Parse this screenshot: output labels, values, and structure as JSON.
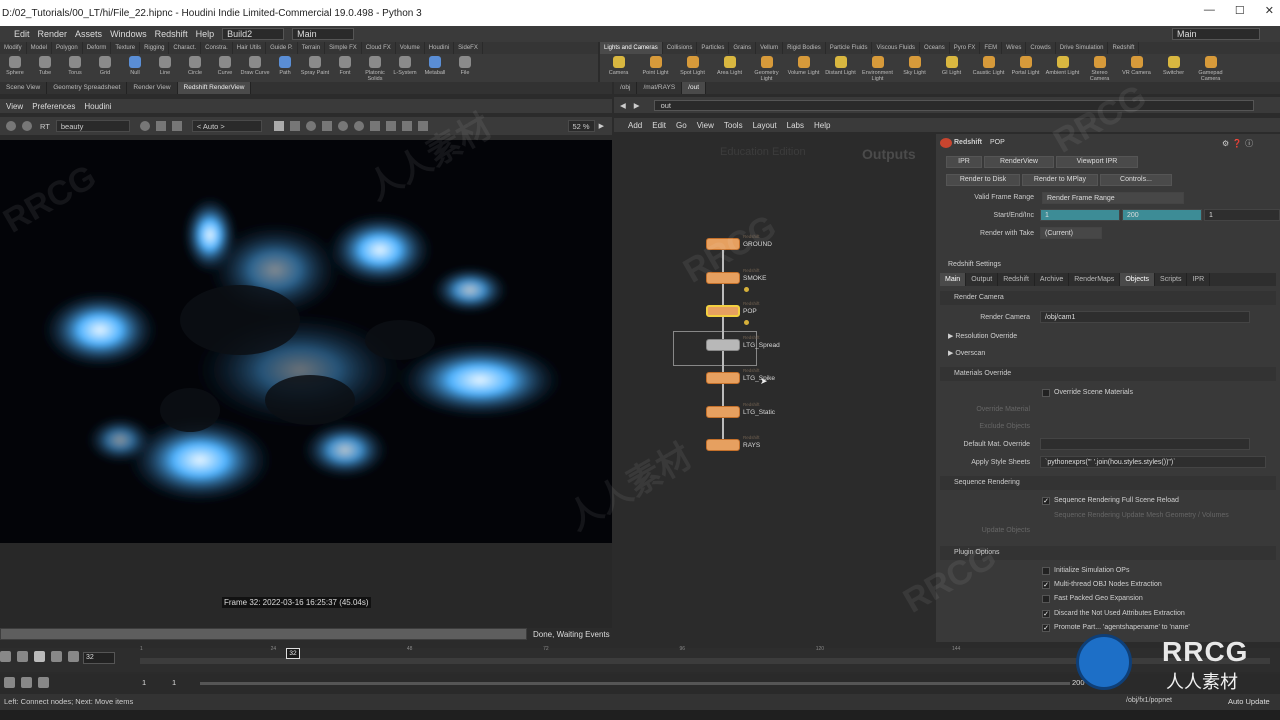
{
  "window": {
    "title": "D:/02_Tutorials/00_LT/hi/File_22.hipnc - Houdini Indie Limited-Commercial 19.0.498 - Python 3",
    "controls": [
      "—",
      "☐",
      "✕"
    ]
  },
  "menubar": {
    "items": [
      "Edit",
      "Render",
      "Assets",
      "Windows",
      "Redshift",
      "Help"
    ],
    "desktop": "Build2",
    "desktop_main": "Main",
    "right_main": "Main"
  },
  "shelf_tabs_left": [
    "Modify",
    "Model",
    "Polygon",
    "Deform",
    "Texture",
    "Rigging",
    "Charact.",
    "Constra.",
    "Hair Utils",
    "Guide P.",
    "Terrain",
    "Simple FX",
    "Cloud FX",
    "Volume",
    "Houdini",
    "SideFX"
  ],
  "shelf_tabs_right": [
    "Lights and Cameras",
    "Collisions",
    "Particles",
    "Grains",
    "Vellum",
    "Rigid Bodies",
    "Particle Fluids",
    "Viscous Fluids",
    "Oceans",
    "Pyro FX",
    "FEM",
    "Wires",
    "Crowds",
    "Drive Simulation",
    "Redshift"
  ],
  "shelf_tools_left": [
    {
      "label": "Sphere",
      "icon": "sphere-icon"
    },
    {
      "label": "Tube",
      "icon": "tube-icon"
    },
    {
      "label": "Torus",
      "icon": "torus-icon"
    },
    {
      "label": "Grid",
      "icon": "grid-icon"
    },
    {
      "label": "Null",
      "icon": "null-icon"
    },
    {
      "label": "Line",
      "icon": "line-icon"
    },
    {
      "label": "Circle",
      "icon": "circle-icon"
    },
    {
      "label": "Curve",
      "icon": "curve-icon"
    },
    {
      "label": "Draw Curve",
      "icon": "draw-curve-icon"
    },
    {
      "label": "Path",
      "icon": "path-icon"
    },
    {
      "label": "Spray Paint",
      "icon": "spray-paint-icon"
    },
    {
      "label": "Font",
      "icon": "font-icon"
    },
    {
      "label": "Platonic Solids",
      "icon": "platonic-icon"
    },
    {
      "label": "L-System",
      "icon": "lsystem-icon"
    },
    {
      "label": "Metaball",
      "icon": "metaball-icon"
    },
    {
      "label": "File",
      "icon": "file-icon"
    }
  ],
  "shelf_tools_right": [
    {
      "label": "Camera",
      "icon": "camera-icon"
    },
    {
      "label": "Point Light",
      "icon": "point-light-icon"
    },
    {
      "label": "Spot Light",
      "icon": "spot-light-icon"
    },
    {
      "label": "Area Light",
      "icon": "area-light-icon"
    },
    {
      "label": "Geometry Light",
      "icon": "geometry-light-icon"
    },
    {
      "label": "Volume Light",
      "icon": "volume-light-icon"
    },
    {
      "label": "Distant Light",
      "icon": "distant-light-icon"
    },
    {
      "label": "Environment Light",
      "icon": "environment-light-icon"
    },
    {
      "label": "Sky Light",
      "icon": "sky-light-icon"
    },
    {
      "label": "GI Light",
      "icon": "gi-light-icon"
    },
    {
      "label": "Caustic Light",
      "icon": "caustic-light-icon"
    },
    {
      "label": "Portal Light",
      "icon": "portal-light-icon"
    },
    {
      "label": "Ambient Light",
      "icon": "ambient-light-icon"
    },
    {
      "label": "Stereo Camera",
      "icon": "stereo-camera-icon"
    },
    {
      "label": "VR Camera",
      "icon": "vr-camera-icon"
    },
    {
      "label": "Switcher",
      "icon": "switcher-icon"
    },
    {
      "label": "Gamepad Camera",
      "icon": "gamepad-camera-icon"
    }
  ],
  "pane_tabs_left": [
    "Scene View",
    "Geometry Spreadsheet",
    "Render View",
    "Redshift RenderView"
  ],
  "viewer": {
    "menu": [
      "View",
      "Preferences",
      "Houdini"
    ],
    "rt_label": "RT",
    "aov": "beauty",
    "auto": "< Auto >",
    "zoom": "52 %",
    "frame_info": "Frame 32: 2022-03-16 16:25:37 (45.04s)",
    "status": "Done, Waiting Events",
    "progress": 1.0
  },
  "network": {
    "path_tabs": [
      "/obj",
      "/mat/RAYS",
      "/out"
    ],
    "path": "out",
    "menu": [
      "Add",
      "Edit",
      "Go",
      "View",
      "Tools",
      "Layout",
      "Labs",
      "Help"
    ],
    "context_label": "Outputs",
    "watermark_label": "Education Edition",
    "nodes": [
      {
        "name": "GROUND",
        "type": "Redshift",
        "selected": false,
        "bypassed": false
      },
      {
        "name": "SMOKE",
        "type": "Redshift",
        "selected": false,
        "bypassed": false
      },
      {
        "name": "POP",
        "type": "Redshift",
        "selected": true,
        "bypassed": false
      },
      {
        "name": "LTG_Spread",
        "type": "Redshift",
        "selected": false,
        "bypassed": true
      },
      {
        "name": "LTG_Spike",
        "type": "Redshift",
        "selected": false,
        "bypassed": false
      },
      {
        "name": "LTG_Static",
        "type": "Redshift",
        "selected": false,
        "bypassed": false
      },
      {
        "name": "RAYS",
        "type": "Redshift",
        "selected": false,
        "bypassed": false
      }
    ]
  },
  "params": {
    "node_type": "Redshift",
    "node_name": "POP",
    "buttons_row1": [
      "IPR",
      "RenderView",
      "Viewport IPR"
    ],
    "buttons_row2": [
      "Render to Disk",
      "Render to MPlay",
      "Controls..."
    ],
    "valid_frame_range_label": "Valid Frame Range",
    "valid_frame_range": "Render Frame Range",
    "start_end_label": "Start/End/Inc",
    "start": "1",
    "end": "200",
    "inc": "1",
    "render_with_take_label": "Render with Take",
    "render_with_take": "(Current)",
    "settings_heading": "Redshift Settings",
    "tabs": [
      "Main",
      "Output",
      "Redshift",
      "Archive",
      "RenderMaps",
      "Objects",
      "Scripts",
      "IPR"
    ],
    "render_camera_section": "Render Camera",
    "render_camera_label": "Render Camera",
    "render_camera": "/obj/cam1",
    "resolution_override": "Resolution Override",
    "overscan": "Overscan",
    "materials_override_section": "Materials Override",
    "override_scene_materials": "Override Scene Materials",
    "override_material": "Override Material",
    "exclude_objects": "Exclude Objects",
    "default_mat_override": "Default Mat. Override",
    "apply_style_sheets_label": "Apply Style Sheets",
    "apply_style_sheets": "`pythonexprs(\"' '.join(hou.styles.styles())\")`",
    "sequence_rendering_section": "Sequence Rendering",
    "seq_full_reload": "Sequence Rendering Full Scene Reload",
    "seq_update_mesh": "Sequence Rendering Update Mesh Geometry / Volumes",
    "update_objects": "Update Objects",
    "plugin_options_section": "Plugin Options",
    "init_sim_ops": "Initialize Simulation OPs",
    "multithread_obj": "Multi-thread OBJ Nodes Extraction",
    "fast_packed": "Fast Packed Geo Expansion",
    "discard_unused": "Discard the Not Used Attributes Extraction",
    "promote_part": "Promote Part... 'agentshapename' to 'name'"
  },
  "timeline": {
    "frame": "32",
    "ticks": [
      "1",
      "24",
      "48",
      "72",
      "96",
      "120",
      "144",
      "168"
    ],
    "range_start": "1",
    "range_start2": "1",
    "range_end": "200"
  },
  "statusbar": {
    "hint": "Left: Connect nodes; Next: Move items",
    "net_path": "/obj/fx1/popnet",
    "auto_update": "Auto Update"
  },
  "watermark": {
    "logo_text": "RRCG",
    "logo_sub": "人人素材"
  },
  "colors": {
    "node_orange": "#e6a060",
    "frame_field_teal": "#3d8c96",
    "render_glow": "#4fb3ff"
  }
}
